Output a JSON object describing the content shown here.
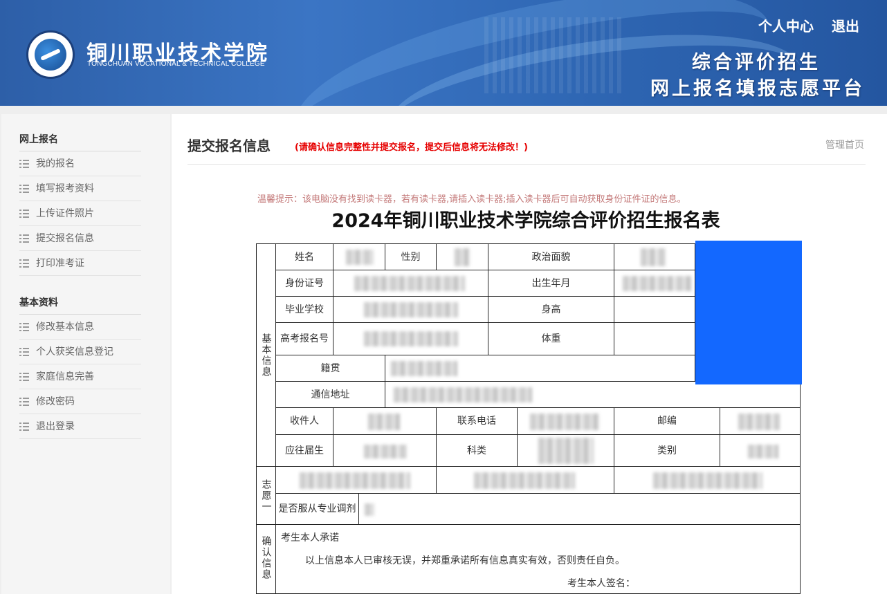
{
  "header": {
    "college_cn": "铜川职业技术学院",
    "college_en": "TONGCHUAN VOCATIONAL & TECHNICAL COLLEGE",
    "platform_line1": "综合评价招生",
    "platform_line2": "网上报名填报志愿平台",
    "links": {
      "personal": "个人中心",
      "logout": "退出"
    }
  },
  "sidebar": {
    "section1": {
      "title": "网上报名",
      "items": [
        "我的报名",
        "填写报考资料",
        "上传证件照片",
        "提交报名信息",
        "打印准考证"
      ]
    },
    "section2": {
      "title": "基本资料",
      "items": [
        "修改基本信息",
        "个人获奖信息登记",
        "家庭信息完善",
        "修改密码",
        "退出登录"
      ]
    }
  },
  "main": {
    "title": "提交报名信息",
    "warning": "(请确认信息完整性并提交报名，提交后信息将无法修改！)",
    "admin_home": "管理首页",
    "tip": "温馨提示：该电脑没有找到读卡器，若有读卡器,请插入读卡器;插入读卡器后可自动获取身份证件证的信息。",
    "form_title": "2024年铜川职业技术学院综合评价招生报名表"
  },
  "form": {
    "section_basic": "基本信息",
    "section_wish": "志愿一",
    "section_confirm": "确认信息",
    "labels": {
      "name": "姓名",
      "gender": "性别",
      "political": "政治面貌",
      "id_number": "身份证号",
      "birth": "出生年月",
      "school": "毕业学校",
      "height": "身高",
      "gaokao_no": "高考报名号",
      "weight": "体重",
      "native": "籍贯",
      "address": "通信地址",
      "recipient": "收件人",
      "phone": "联系电话",
      "postcode": "邮编",
      "grad_type": "应往届生",
      "subject": "科类",
      "category": "类别",
      "obey_adjust": "是否服从专业调剂"
    },
    "pledge_title": "考生本人承诺",
    "pledge_text": "以上信息本人已审核无误，并郑重承诺所有信息真实有效，否则责任自负。",
    "signature": "考生本人签名："
  }
}
